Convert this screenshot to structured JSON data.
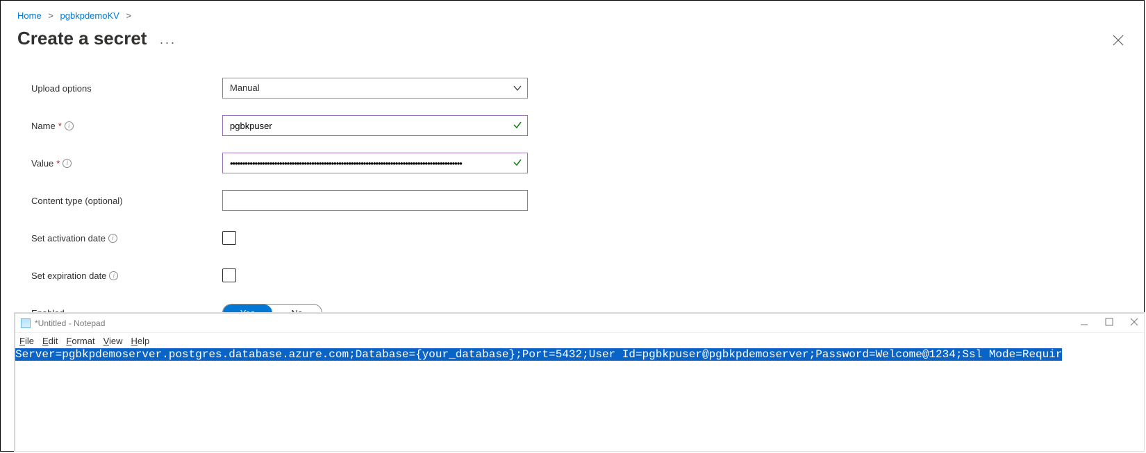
{
  "breadcrumbs": {
    "home": "Home",
    "kv": "pgbkpdemoKV"
  },
  "page": {
    "title": "Create a secret",
    "more": "···"
  },
  "form": {
    "upload_label": "Upload options",
    "upload_value": "Manual",
    "name_label": "Name",
    "name_value": "pgbkpuser",
    "value_label": "Value",
    "value_value": "••••••••••••••••••••••••••••••••••••••••••••••••••••••••••••••••••••••••••••••••••••••••••••••",
    "content_type_label": "Content type (optional)",
    "content_type_value": "",
    "activation_label": "Set activation date",
    "expiration_label": "Set expiration date",
    "enabled_label": "Enabled",
    "enabled_yes": "Yes",
    "enabled_no": "No"
  },
  "notepad": {
    "title": "*Untitled - Notepad",
    "menu": {
      "file": "File",
      "edit": "Edit",
      "format": "Format",
      "view": "View",
      "help": "Help"
    },
    "content": "Server=pgbkpdemoserver.postgres.database.azure.com;Database={your_database};Port=5432;User Id=pgbkpuser@pgbkpdemoserver;Password=Welcome@1234;Ssl Mode=Requir"
  }
}
